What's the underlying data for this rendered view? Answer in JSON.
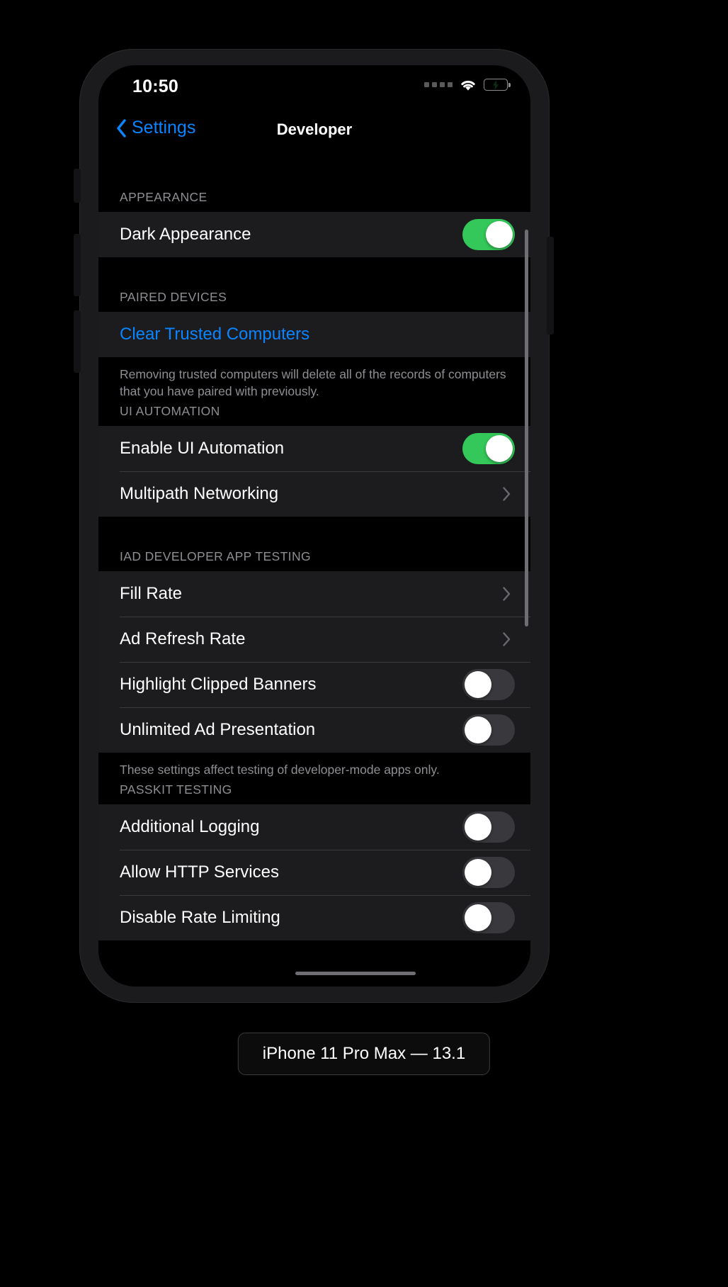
{
  "window": {
    "device_label": "iPhone 11 Pro Max — 13.1"
  },
  "statusbar": {
    "time": "10:50",
    "cellular_icon": "cellular-dots-icon",
    "wifi_icon": "wifi-icon",
    "battery_icon": "battery-charging-icon",
    "battery_color": "#34c759"
  },
  "navbar": {
    "back_label": "Settings",
    "back_icon": "chevron-left-icon",
    "title": "Developer",
    "tint_color": "#0a84ff"
  },
  "sections": [
    {
      "header": "APPEARANCE",
      "rows": [
        {
          "label": "Dark Appearance",
          "type": "switch",
          "value": "on"
        }
      ],
      "footer": ""
    },
    {
      "header": "PAIRED DEVICES",
      "rows": [
        {
          "label": "Clear Trusted Computers",
          "type": "link"
        }
      ],
      "footer": "Removing trusted computers will delete all of the records of computers that you have paired with previously."
    },
    {
      "header": "UI AUTOMATION",
      "rows": [
        {
          "label": "Enable UI Automation",
          "type": "switch",
          "value": "on"
        },
        {
          "label": "Multipath Networking",
          "type": "disclosure"
        }
      ],
      "footer": ""
    },
    {
      "header": "IAD DEVELOPER APP TESTING",
      "rows": [
        {
          "label": "Fill Rate",
          "type": "disclosure"
        },
        {
          "label": "Ad Refresh Rate",
          "type": "disclosure"
        },
        {
          "label": "Highlight Clipped Banners",
          "type": "switch",
          "value": "off"
        },
        {
          "label": "Unlimited Ad Presentation",
          "type": "switch",
          "value": "off"
        }
      ],
      "footer": "These settings affect testing of developer-mode apps only."
    },
    {
      "header": "PASSKIT TESTING",
      "rows": [
        {
          "label": "Additional Logging",
          "type": "switch",
          "value": "off"
        },
        {
          "label": "Allow HTTP Services",
          "type": "switch",
          "value": "off"
        },
        {
          "label": "Disable Rate Limiting",
          "type": "switch",
          "value": "off"
        }
      ],
      "footer": ""
    }
  ],
  "icons": {
    "disclosure": "chevron-right-icon",
    "scrollbar_vertical": "vertical-scrollbar",
    "scrollbar_horizontal": "horizontal-scrollbar"
  }
}
